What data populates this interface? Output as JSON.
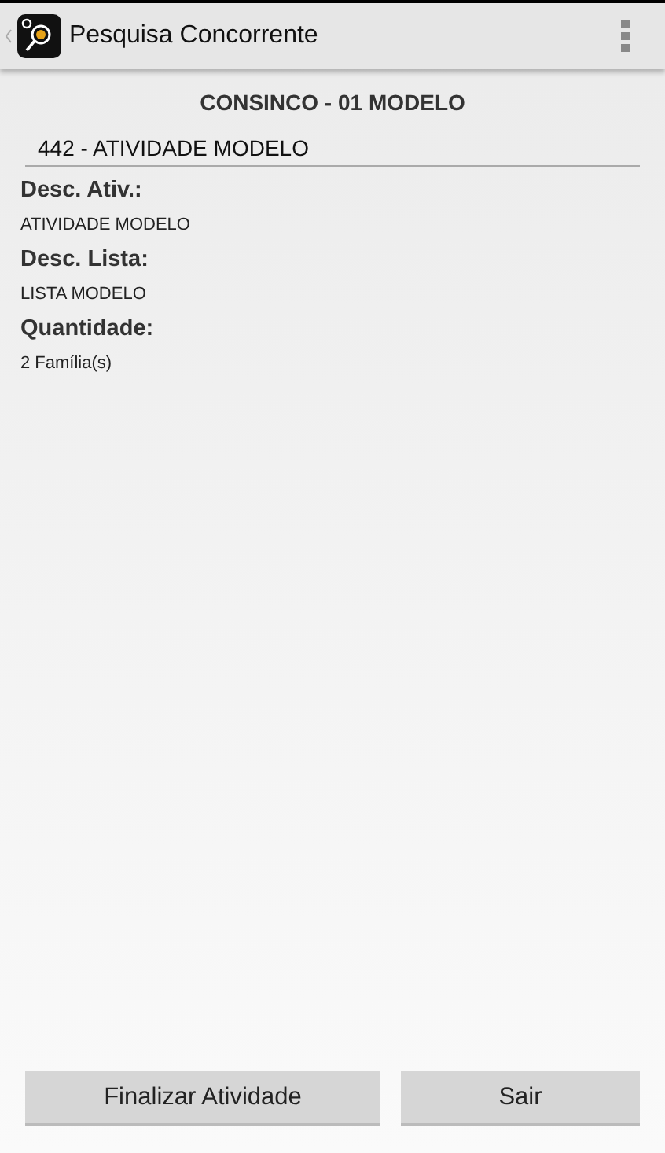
{
  "app_bar": {
    "title": "Pesquisa Concorrente"
  },
  "heading": "CONSINCO - 01 MODELO",
  "activity_field": {
    "value": "442 - ATIVIDADE MODELO"
  },
  "details": [
    {
      "label": "Desc. Ativ.:",
      "value": "ATIVIDADE MODELO"
    },
    {
      "label": "Desc. Lista:",
      "value": "LISTA MODELO"
    },
    {
      "label": "Quantidade:",
      "value": "2 Família(s)"
    }
  ],
  "buttons": [
    "Finalizar Atividade",
    "Sair"
  ]
}
